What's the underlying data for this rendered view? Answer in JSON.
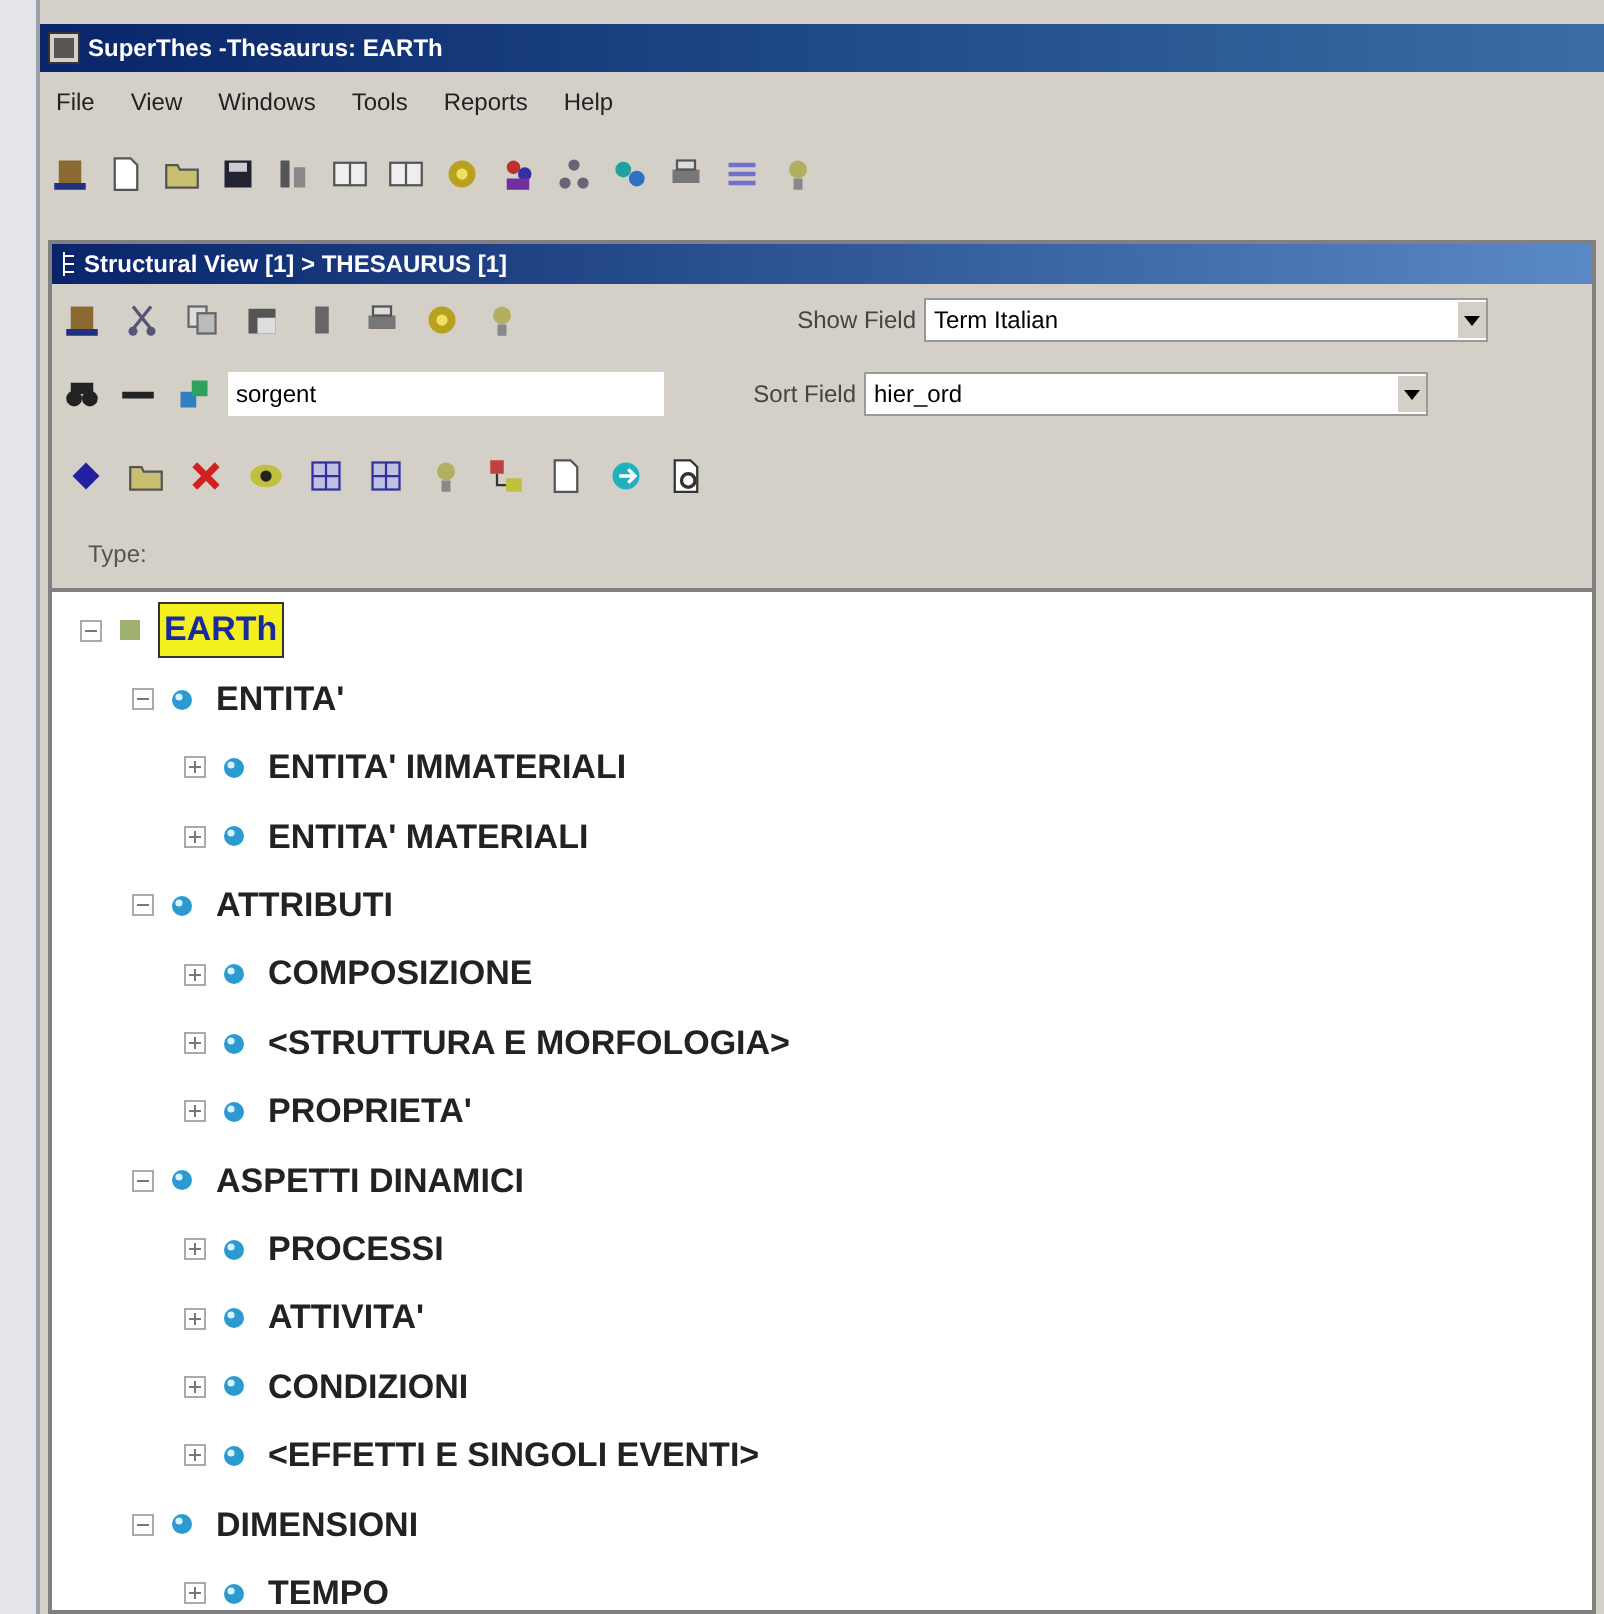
{
  "window": {
    "title": "SuperThes -Thesaurus: EARTh"
  },
  "menu": [
    "File",
    "View",
    "Windows",
    "Tools",
    "Reports",
    "Help"
  ],
  "inner_window": {
    "title": "Structural View [1] > THESAURUS [1]"
  },
  "show_field": {
    "label": "Show Field",
    "value": "Term Italian"
  },
  "search": {
    "value": "sorgent"
  },
  "sort_field": {
    "label": "Sort Field",
    "value": "hier_ord"
  },
  "type_label": "Type:",
  "tree": [
    {
      "label": "EARTh",
      "kind": "root",
      "selected": true,
      "expanded": true,
      "children": [
        {
          "label": "ENTITA'",
          "kind": "term",
          "selected": false,
          "expanded": true,
          "children": [
            {
              "label": "ENTITA' IMMATERIALI",
              "kind": "term",
              "selected": false,
              "expanded": false
            },
            {
              "label": "ENTITA' MATERIALI",
              "kind": "term",
              "selected": false,
              "expanded": false
            }
          ]
        },
        {
          "label": "ATTRIBUTI",
          "kind": "term",
          "selected": false,
          "expanded": true,
          "children": [
            {
              "label": "COMPOSIZIONE",
              "kind": "term",
              "selected": false,
              "expanded": false
            },
            {
              "label": "<STRUTTURA E MORFOLOGIA>",
              "kind": "term",
              "selected": false,
              "expanded": false
            },
            {
              "label": "PROPRIETA'",
              "kind": "term",
              "selected": false,
              "expanded": false
            }
          ]
        },
        {
          "label": "ASPETTI DINAMICI",
          "kind": "term",
          "selected": false,
          "expanded": true,
          "children": [
            {
              "label": "PROCESSI",
              "kind": "term",
              "selected": false,
              "expanded": false
            },
            {
              "label": "ATTIVITA'",
              "kind": "term",
              "selected": false,
              "expanded": false
            },
            {
              "label": "CONDIZIONI",
              "kind": "term",
              "selected": false,
              "expanded": false
            },
            {
              "label": "<EFFETTI E SINGOLI EVENTI>",
              "kind": "term",
              "selected": false,
              "expanded": false
            }
          ]
        },
        {
          "label": "DIMENSIONI",
          "kind": "term",
          "selected": false,
          "expanded": true,
          "children": [
            {
              "label": "TEMPO",
              "kind": "term",
              "selected": false,
              "expanded": false
            }
          ]
        }
      ]
    }
  ]
}
